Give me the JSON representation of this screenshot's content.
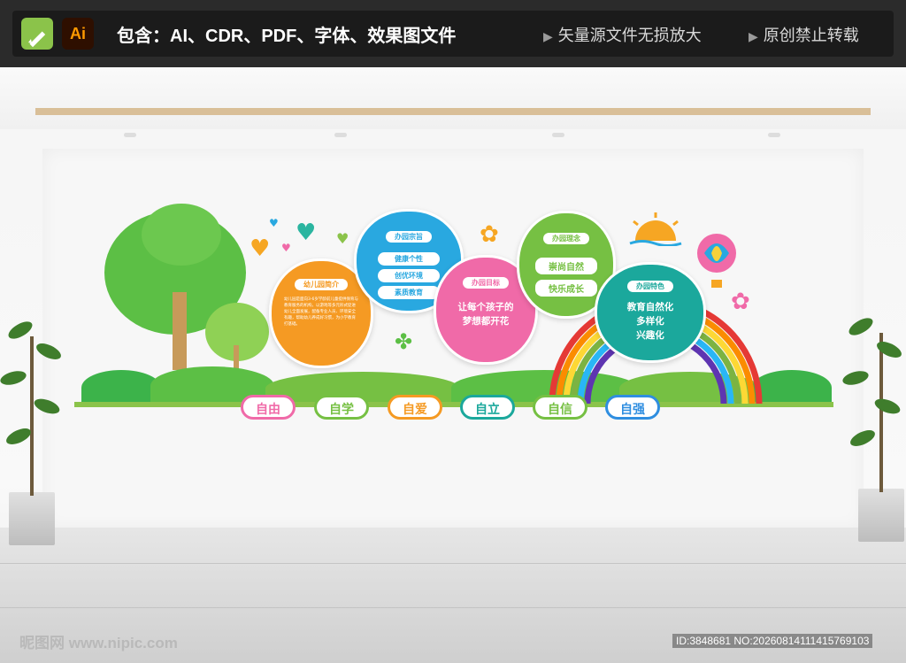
{
  "banner": {
    "edit_icon": "pencil-icon",
    "ai_label": "Ai",
    "includes": "包含：AI、CDR、PDF、字体、效果图文件",
    "notice1": "矢量源文件无损放大",
    "notice2": "原创禁止转载"
  },
  "clouds": {
    "intro": {
      "title": "幼儿园简介",
      "text": "幼儿园是面向3-6岁学龄前儿童提供保育与教育服务的机构，以游戏等多元形式促进幼儿全面发展，配备专业人员、环境安全有趣，帮助幼儿养成好习惯，为小学教育打基础。"
    },
    "purpose": {
      "title": "办园宗旨",
      "items": [
        "健康个性",
        "创优环境",
        "素质教育"
      ]
    },
    "goal": {
      "title": "办园目标",
      "line1": "让每个孩子的",
      "line2": "梦想都开花"
    },
    "concept": {
      "title": "办园理念",
      "items": [
        "崇尚自然",
        "快乐成长"
      ]
    },
    "feature": {
      "title": "办园特色",
      "line1": "教育自然化",
      "line2": "多样化",
      "line3": "兴趣化"
    }
  },
  "values": [
    "自由",
    "自学",
    "自爱",
    "自立",
    "自信",
    "自强"
  ],
  "colors": {
    "orange": "#f59a23",
    "blue": "#29a8e0",
    "pink": "#f06aa8",
    "green": "#76c043",
    "teal": "#1ba89c",
    "sky": "#2f8ee0"
  },
  "watermark": {
    "left": "昵图网 www.nipic.com",
    "right": "ID:3848681 NO:20260814111415769103"
  }
}
